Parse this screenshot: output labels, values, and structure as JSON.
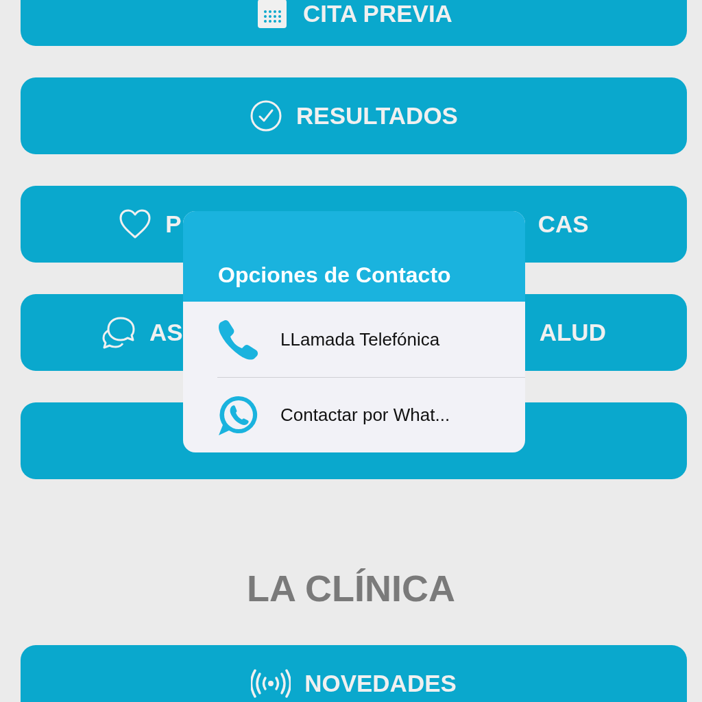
{
  "menu_buttons": [
    {
      "kind": "calendar",
      "label": "CITA PREVIA"
    },
    {
      "kind": "check",
      "label": "RESULTADOS"
    },
    {
      "kind": "heart",
      "label_start": "P",
      "label_end": "CAS"
    },
    {
      "kind": "chat",
      "label_start": "AS",
      "label_end": "ALUD"
    },
    {
      "kind": "covered"
    }
  ],
  "section_title": "LA CLÍNICA",
  "section_buttons": [
    {
      "kind": "broadcast",
      "label": "NOVEDADES"
    }
  ],
  "contact_popup": {
    "title": "Opciones de Contacto",
    "options": [
      {
        "kind": "phone",
        "label": "LLamada Telefónica"
      },
      {
        "kind": "whatsapp",
        "label": "Contactar por What..."
      }
    ]
  }
}
